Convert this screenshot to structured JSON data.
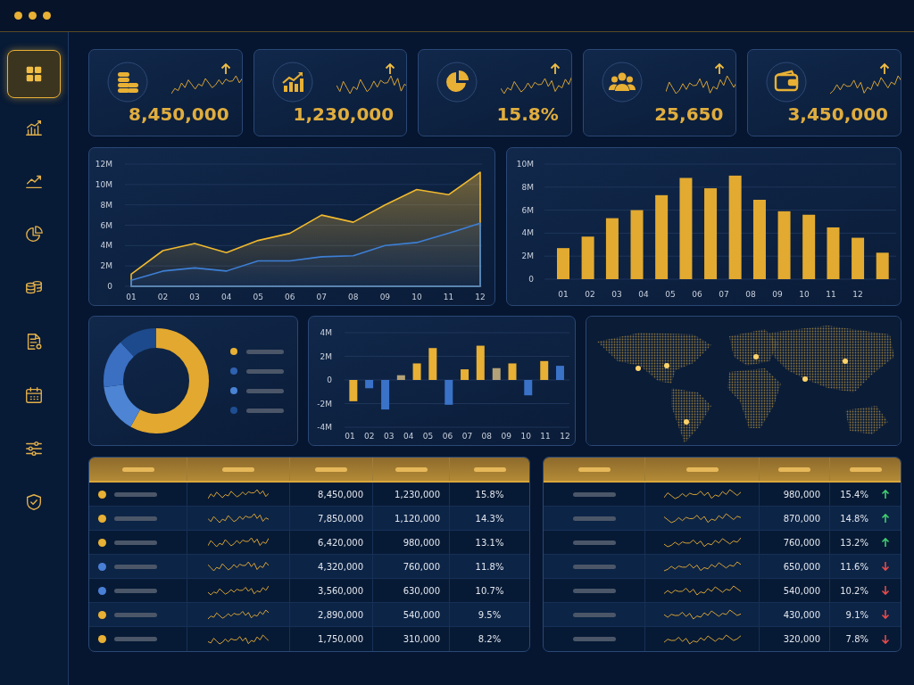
{
  "sidebar": {
    "items": [
      {
        "selected": true
      },
      {
        "selected": false
      },
      {
        "selected": false
      },
      {
        "selected": false
      },
      {
        "selected": false
      },
      {
        "selected": false
      },
      {
        "selected": false
      },
      {
        "selected": false
      },
      {
        "selected": false
      }
    ]
  },
  "kpis": [
    {
      "value": "8,450,000",
      "up": true
    },
    {
      "value": "1,230,000",
      "up": true
    },
    {
      "value": "15.8%",
      "up": true
    },
    {
      "value": "25,650",
      "up": true
    },
    {
      "value": "3,450,000",
      "up": true
    }
  ],
  "line_chart": {
    "chart_data": {
      "type": "area",
      "grid": true,
      "categories": [
        "01",
        "02",
        "03",
        "04",
        "05",
        "06",
        "07",
        "08",
        "09",
        "10",
        "11",
        "12"
      ],
      "yticks": [
        {
          "value": 0,
          "label": "0"
        },
        {
          "value": 2,
          "label": "2M"
        },
        {
          "value": 4,
          "label": "4M"
        },
        {
          "value": 6,
          "label": "6M"
        },
        {
          "value": 8,
          "label": "8M"
        },
        {
          "value": 10,
          "label": "10M"
        },
        {
          "value": 12,
          "label": "12M"
        }
      ],
      "ylim": [
        0,
        12
      ],
      "series": [
        {
          "color": "#f0b92e",
          "values": [
            1.2,
            3.5,
            4.2,
            3.3,
            4.5,
            5.2,
            7.0,
            6.3,
            8.0,
            9.5,
            9.0,
            11.2
          ]
        },
        {
          "color": "#3d7fd6",
          "values": [
            0.6,
            1.5,
            1.8,
            1.5,
            2.5,
            2.5,
            2.9,
            3.0,
            4.0,
            4.3,
            5.2,
            6.2
          ]
        }
      ]
    }
  },
  "bar_chart": {
    "chart_data": {
      "type": "bar",
      "grid": true,
      "xlim": [
        0.3,
        13.43
      ],
      "x": [
        1,
        1.92,
        2.83,
        3.75,
        4.67,
        5.58,
        6.5,
        7.42,
        8.33,
        9.25,
        10.17,
        11.08,
        12,
        12.92
      ],
      "xticks": [
        {
          "value": 1,
          "label": "01"
        },
        {
          "value": 2,
          "label": "02"
        },
        {
          "value": 3,
          "label": "03"
        },
        {
          "value": 4,
          "label": "04"
        },
        {
          "value": 5,
          "label": "05"
        },
        {
          "value": 6,
          "label": "06"
        },
        {
          "value": 7,
          "label": "07"
        },
        {
          "value": 8,
          "label": "08"
        },
        {
          "value": 9,
          "label": "09"
        },
        {
          "value": 10,
          "label": "10"
        },
        {
          "value": 11,
          "label": "11"
        },
        {
          "value": 12,
          "label": "12"
        }
      ],
      "yticks": [
        {
          "value": 0,
          "label": "0"
        },
        {
          "value": 2,
          "label": "2M"
        },
        {
          "value": 4,
          "label": "4M"
        },
        {
          "value": 6,
          "label": "6M"
        },
        {
          "value": 8,
          "label": "8M"
        },
        {
          "value": 10,
          "label": "10M"
        }
      ],
      "ylim": [
        0,
        10
      ],
      "series": [
        {
          "color": "#e2aa30",
          "values": [
            2.7,
            3.7,
            5.3,
            6.0,
            7.3,
            8.8,
            7.9,
            9.0,
            6.9,
            5.9,
            5.6,
            4.5,
            3.6,
            2.3
          ]
        }
      ]
    }
  },
  "donut_legend": [
    {
      "color": "#e8b034"
    },
    {
      "color": "#2f62b0"
    },
    {
      "color": "#4a82d4"
    },
    {
      "color": "#1f4d91"
    }
  ],
  "diverging_chart": {
    "chart_data": {
      "type": "bar",
      "grid": true,
      "xlim": [
        0.73,
        12.23
      ],
      "x": [
        1.18,
        1.99,
        2.81,
        3.62,
        4.43,
        5.24,
        6.06,
        6.87,
        7.68,
        8.5,
        9.31,
        10.12,
        10.94,
        11.75
      ],
      "xticks": [
        {
          "value": 1,
          "label": "01"
        },
        {
          "value": 2,
          "label": "02"
        },
        {
          "value": 3,
          "label": "03"
        },
        {
          "value": 4,
          "label": "04"
        },
        {
          "value": 5,
          "label": "05"
        },
        {
          "value": 6,
          "label": "06"
        },
        {
          "value": 7,
          "label": "07"
        },
        {
          "value": 8,
          "label": "08"
        },
        {
          "value": 9,
          "label": "09"
        },
        {
          "value": 10,
          "label": "10"
        },
        {
          "value": 11,
          "label": "11"
        },
        {
          "value": 12,
          "label": "12"
        }
      ],
      "yticks": [
        {
          "value": -4,
          "label": "-4M"
        },
        {
          "value": -2,
          "label": "-2M"
        },
        {
          "value": 0,
          "label": "0"
        },
        {
          "value": 2,
          "label": "2M"
        },
        {
          "value": 4,
          "label": "4M"
        }
      ],
      "ylim": [
        -4,
        4
      ],
      "series": [
        {
          "color": "#e8b034",
          "values": [
            -1.8,
            null,
            null,
            null,
            1.4,
            2.7,
            null,
            0.9,
            2.9,
            null,
            1.4,
            null,
            1.6,
            null
          ]
        },
        {
          "color": "#3a72c8",
          "values": [
            null,
            -0.7,
            -2.5,
            null,
            null,
            null,
            -2.1,
            null,
            null,
            null,
            null,
            -1.3,
            null,
            1.2
          ]
        },
        {
          "color": "#b3a278",
          "values": [
            null,
            null,
            null,
            0.4,
            null,
            null,
            null,
            null,
            null,
            1.0,
            null,
            null,
            null,
            null
          ]
        }
      ]
    }
  },
  "left_table": {
    "rows": [
      {
        "color": "#e8b034",
        "column_3": "8,450,000",
        "column_4": "1,230,000",
        "column_5": "15.8%"
      },
      {
        "color": "#e8b034",
        "column_3": "7,850,000",
        "column_4": "1,120,000",
        "column_5": "14.3%"
      },
      {
        "color": "#e8b034",
        "column_3": "6,420,000",
        "column_4": "980,000",
        "column_5": "13.1%"
      },
      {
        "color": "#4a7fd6",
        "column_3": "4,320,000",
        "column_4": "760,000",
        "column_5": "11.8%"
      },
      {
        "color": "#4a7fd6",
        "column_3": "3,560,000",
        "column_4": "630,000",
        "column_5": "10.7%"
      },
      {
        "color": "#e8b034",
        "column_3": "2,890,000",
        "column_4": "540,000",
        "column_5": "9.5%"
      },
      {
        "color": "#e8b034",
        "column_3": "1,750,000",
        "column_4": "310,000",
        "column_5": "8.2%"
      }
    ]
  },
  "right_table": {
    "rows": [
      {
        "column_3": "980,000",
        "column_4": "15.4%",
        "up": true
      },
      {
        "column_3": "870,000",
        "column_4": "14.8%",
        "up": true
      },
      {
        "column_3": "760,000",
        "column_4": "13.2%",
        "up": true
      },
      {
        "column_3": "650,000",
        "column_4": "11.6%",
        "up": false
      },
      {
        "column_3": "540,000",
        "column_4": "10.2%",
        "up": false
      },
      {
        "column_3": "430,000",
        "column_4": "9.1%",
        "up": false
      },
      {
        "column_3": "320,000",
        "column_4": "7.8%",
        "up": false
      }
    ]
  }
}
